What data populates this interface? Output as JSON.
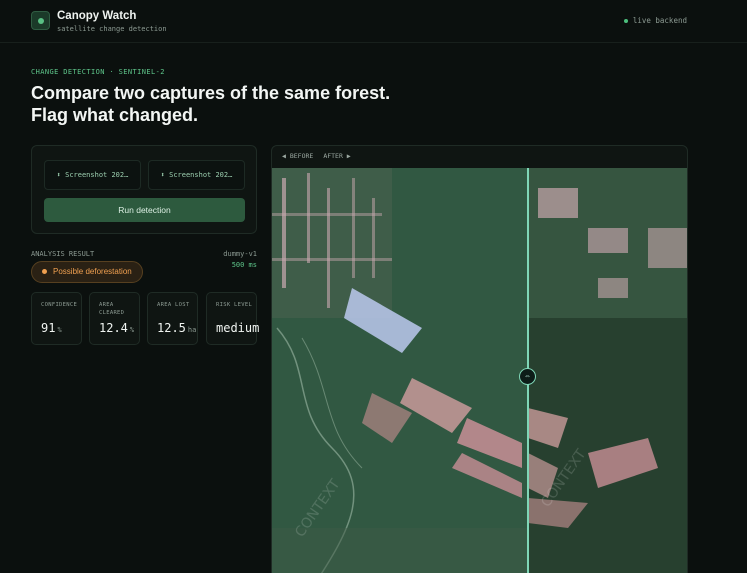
{
  "app": {
    "name": "Canopy Watch",
    "tagline": "satellite change detection",
    "status": "live backend"
  },
  "hero": {
    "eyebrow": "CHANGE DETECTION · SENTINEL-2",
    "headline": "Compare two captures of the same forest. Flag what changed."
  },
  "uploads": {
    "before_file": "Screenshot 202…",
    "after_file": "Screenshot 202…",
    "run_label": "Run detection"
  },
  "result": {
    "label": "ANALYSIS RESULT",
    "model": "dummy-v1",
    "latency": "500 ms",
    "verdict": "Possible deforestation",
    "metrics": [
      {
        "label": "CONFIDENCE",
        "value": "91",
        "unit": "%"
      },
      {
        "label": "AREA CLEARED",
        "value": "12.4",
        "unit": "%"
      },
      {
        "label": "AREA LOST",
        "value": "12.5",
        "unit": "ha"
      },
      {
        "label": "RISK LEVEL",
        "value": "medium",
        "unit": ""
      }
    ]
  },
  "viewer": {
    "before_label": "◀ BEFORE",
    "after_label": "AFTER ▶",
    "handle_glyph": "⇔"
  },
  "colors": {
    "accent": "#5ec58a",
    "warning": "#f0a050",
    "background": "#0b100e",
    "divider": "#7fd6b7"
  }
}
